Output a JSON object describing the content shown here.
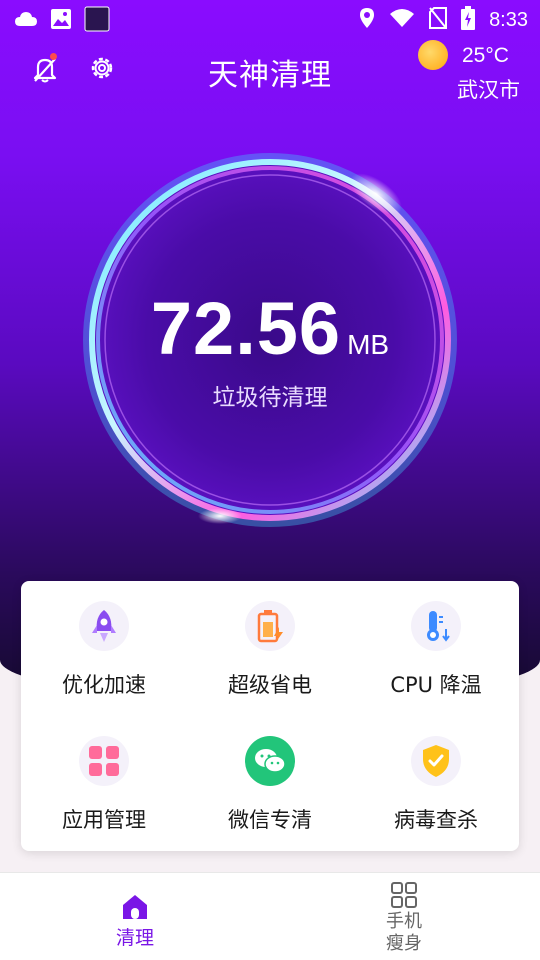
{
  "status_bar": {
    "time": "8:33",
    "left_icons": [
      "cloud-icon",
      "image-icon",
      "app-square-icon"
    ],
    "right_icons": [
      "location-icon",
      "wifi-icon",
      "no-sim-icon",
      "battery-icon"
    ]
  },
  "header": {
    "title": "天神清理",
    "weather": {
      "temperature": "25°C",
      "city": "武汉市",
      "icon": "sun-icon"
    }
  },
  "cleaner": {
    "value": "72.56",
    "unit": "MB",
    "label": "垃圾待清理"
  },
  "features": [
    {
      "label": "优化加速",
      "icon": "rocket-icon"
    },
    {
      "label": "超级省电",
      "icon": "battery-charge-icon"
    },
    {
      "label": "CPU 降温",
      "icon": "thermometer-icon"
    },
    {
      "label": "应用管理",
      "icon": "apps-grid-icon"
    },
    {
      "label": "微信专清",
      "icon": "wechat-icon"
    },
    {
      "label": "病毒查杀",
      "icon": "shield-check-icon"
    }
  ],
  "tabbar": {
    "tabs": [
      {
        "label": "清理",
        "icon": "home-icon",
        "active": true
      },
      {
        "label": "手机\n瘦身",
        "icon": "grid-icon",
        "active": false
      }
    ]
  },
  "colors": {
    "accent": "#7a16e6",
    "hero_top": "#8a0cff",
    "hero_bottom": "#140a2c"
  }
}
